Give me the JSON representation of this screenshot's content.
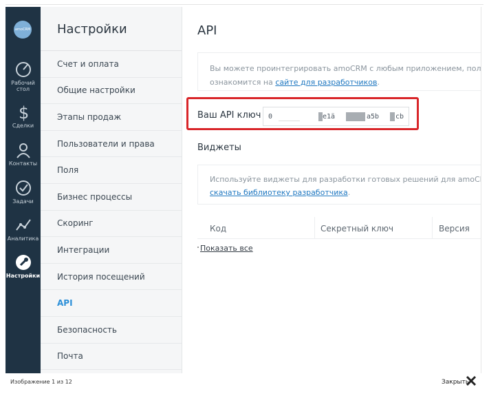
{
  "caption": "Изображение 1 из 12",
  "close_label": "Закрыть",
  "logo_text": "amoCRM",
  "rail": [
    {
      "label_1": "Рабочий",
      "label_2": "стол",
      "icon": "dashboard-icon"
    },
    {
      "label_1": "Сделки",
      "label_2": "",
      "icon": "deals-icon"
    },
    {
      "label_1": "Контакты",
      "label_2": "",
      "icon": "contacts-icon"
    },
    {
      "label_1": "Задачи",
      "label_2": "",
      "icon": "tasks-icon"
    },
    {
      "label_1": "Аналитика",
      "label_2": "",
      "icon": "analytics-icon"
    },
    {
      "label_1": "Настройки",
      "label_2": "",
      "icon": "settings-icon"
    }
  ],
  "menu": {
    "title": "Настройки",
    "items": [
      "Счет и оплата",
      "Общие настройки",
      "Этапы продаж",
      "Пользователи и права",
      "Поля",
      "Бизнес процессы",
      "Скоринг",
      "Интеграции",
      "История посещений",
      "API",
      "Безопасность",
      "Почта"
    ],
    "active": "API"
  },
  "main": {
    "title": "API",
    "info_text": "Вы можете проинтегрировать amoCRM с любым приложением, получив дост",
    "info_text_2": "ознакомится на ",
    "info_link": "сайте для разработчиков",
    "info_tail": ".",
    "api_label": "Ваш API ключ",
    "api_key_parts": [
      "0",
      "e1ä",
      "a5b",
      "cb"
    ],
    "widgets_title": "Виджеты",
    "widgets_text": "Используйте виджеты для разработки готовых решений для amoCRM. Вы см",
    "widgets_link": "скачать библиотеку разработчика",
    "widgets_tail": ".",
    "columns": [
      "Код",
      "Секретный ключ",
      "Версия"
    ],
    "show_all": "Показать все"
  },
  "colors": {
    "rail_bg": "#1f3344",
    "accent": "#2b8fd8",
    "highlight": "#d9262a",
    "link": "#1e77c0"
  }
}
